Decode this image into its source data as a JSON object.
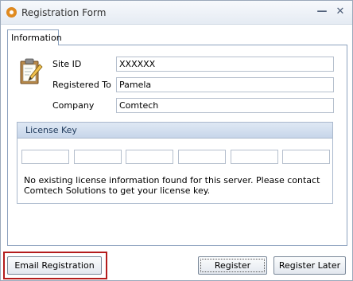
{
  "window": {
    "title": "Registration Form",
    "minimize_glyph": "—",
    "close_glyph": "✕",
    "icon": "app-circle-icon"
  },
  "tabs": [
    {
      "label": "Information",
      "selected": true
    }
  ],
  "form": {
    "icon": "clipboard-pencil-icon",
    "site_id": {
      "label": "Site ID",
      "value": "XXXXXX"
    },
    "registered_to": {
      "label": "Registered To",
      "value": "Pamela"
    },
    "company": {
      "label": "Company",
      "value": "Comtech"
    }
  },
  "license_key": {
    "header": "License Key",
    "segments": [
      "",
      "",
      "",
      "",
      "",
      ""
    ],
    "message": "No existing license information found for this server. Please contact Comtech Solutions to get your license key."
  },
  "buttons": {
    "email_registration": "Email Registration",
    "register": "Register",
    "register_later": "Register Later"
  },
  "colors": {
    "highlight_border": "#b41c1c",
    "header_gradient_top": "#dfe8f4",
    "header_gradient_bottom": "#c7d6ea"
  }
}
